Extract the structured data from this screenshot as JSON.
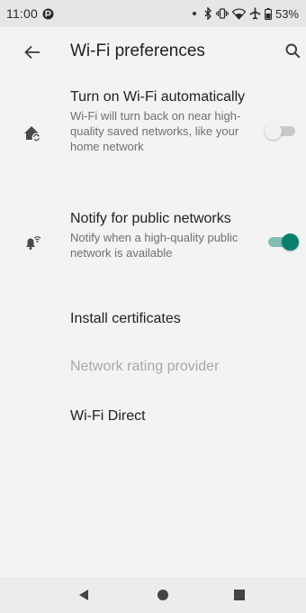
{
  "status_bar": {
    "time": "11:00",
    "battery": "53%"
  },
  "app_bar": {
    "title": "Wi-Fi preferences"
  },
  "preferences": [
    {
      "title": "Turn on Wi-Fi automatically",
      "summary": "Wi-Fi will turn back on near high-quality saved networks, like your home network",
      "icon": "wifi-home-sync-icon",
      "switch": "off"
    },
    {
      "title": "Notify for public networks",
      "summary": "Notify when a high-quality public network is available",
      "icon": "notification-wifi-icon",
      "switch": "on"
    },
    {
      "title": "Install certificates"
    },
    {
      "title": "Network rating provider",
      "disabled": true
    },
    {
      "title": "Wi-Fi Direct"
    }
  ],
  "colors": {
    "accent": "#087f6d",
    "switch_on_track": "#7fbfb1",
    "switch_off_track": "#c9c9c9",
    "background": "#f3f3f3",
    "status_bar": "#e6e6e6",
    "nav_bar": "#ececec",
    "disabled_text": "#a8a8a8"
  },
  "icons": {
    "back": "arrow-back-icon",
    "search": "search-icon",
    "nav_back": "triangle-back-icon",
    "nav_home": "circle-home-icon",
    "nav_recents": "square-recents-icon"
  }
}
